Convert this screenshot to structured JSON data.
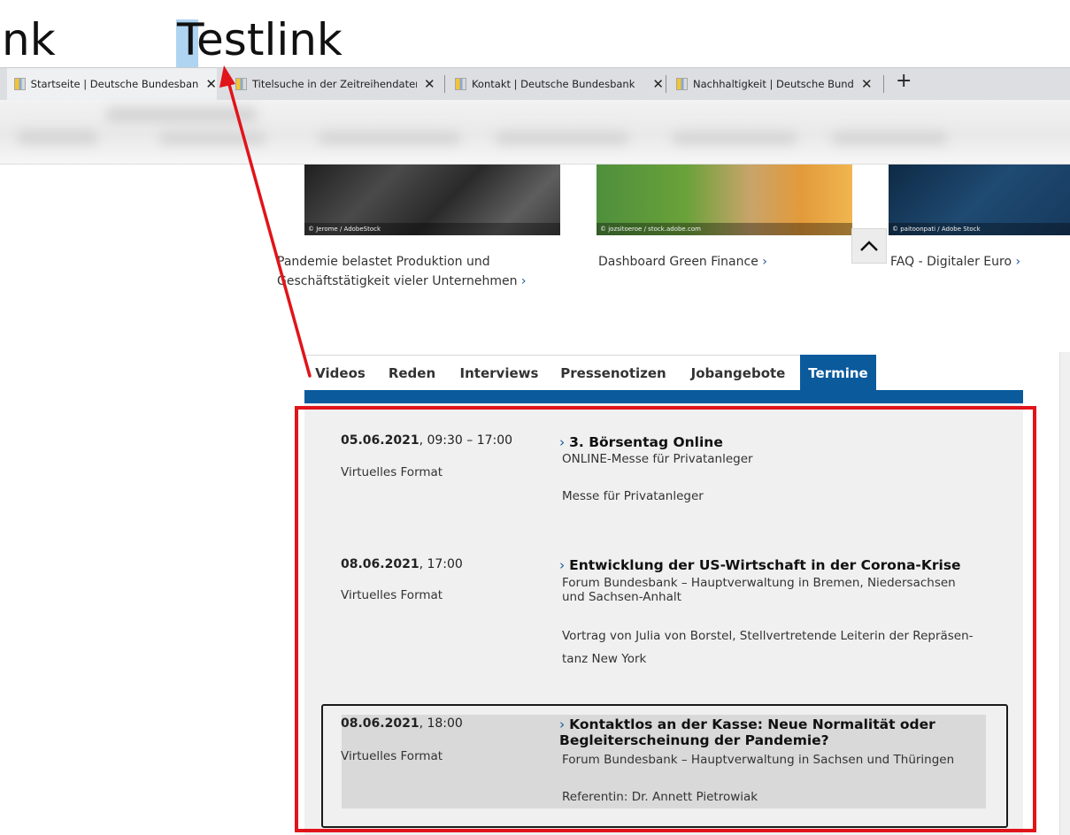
{
  "editor": {
    "left_text": "nk",
    "right_text": "Testlink"
  },
  "browser_tabs": [
    {
      "label": "Startseite | Deutsche Bundesbank"
    },
    {
      "label": "Titelsuche in der Zeitreihendaten"
    },
    {
      "label": "Kontakt | Deutsche Bundesbank"
    },
    {
      "label": "Nachhaltigkeit | Deutsche Bunde"
    }
  ],
  "teasers": [
    {
      "credit": "© Jerome / AdobeStock",
      "line1": "Pandemie belastet Produktion und",
      "line2": "Geschäftstätigkeit vieler Unternehmen"
    },
    {
      "credit": "© jozsitoeroe / stock.adobe.com",
      "line1": "Dashboard Green Finance"
    },
    {
      "credit": "© paitoonpati / Adobe Stock",
      "line1": "FAQ - Digitaler Euro"
    }
  ],
  "content_tabs": [
    "Videos",
    "Reden",
    "Interviews",
    "Pressenotizen",
    "Jobangebote",
    "Termine"
  ],
  "events": [
    {
      "date": "05.06.2021",
      "time": ", 09:30  – 17:00",
      "format": "Virtuelles Format",
      "title": "3. Börsentag Online",
      "subtitle": "ONLINE-Messe für Privatanleger",
      "description": "Messe für Privatanleger"
    },
    {
      "date": "08.06.2021",
      "time": ", 17:00",
      "format": "Virtuelles Format",
      "title": "Entwicklung der US-Wirtschaft in der Corona-Krise",
      "subtitle_line1": "Forum Bundesbank – Hauptverwaltung in Bremen, Niedersachsen",
      "subtitle_line2": "und Sachsen-Anhalt",
      "desc_line1": "Vortrag von Julia von Borstel, Stellvertretende Leiterin der Repräsen-",
      "desc_line2": "tanz New York"
    },
    {
      "date": "08.06.2021",
      "time": ", 18:00",
      "format": "Virtuelles Format",
      "title_line1": "Kontaktlos an der Kasse: Neue Normalität oder",
      "title_line2": "Begleiterscheinung der Pandemie?",
      "subtitle": "Forum Bundesbank – Hauptverwaltung in Sachsen und Thüringen",
      "description": "Referentin: Dr. Annett Pietrowiak"
    }
  ],
  "colors": {
    "accent_blue": "#0a5a9c",
    "annotation_red": "#e0141a",
    "selection": "#aed4f2"
  }
}
